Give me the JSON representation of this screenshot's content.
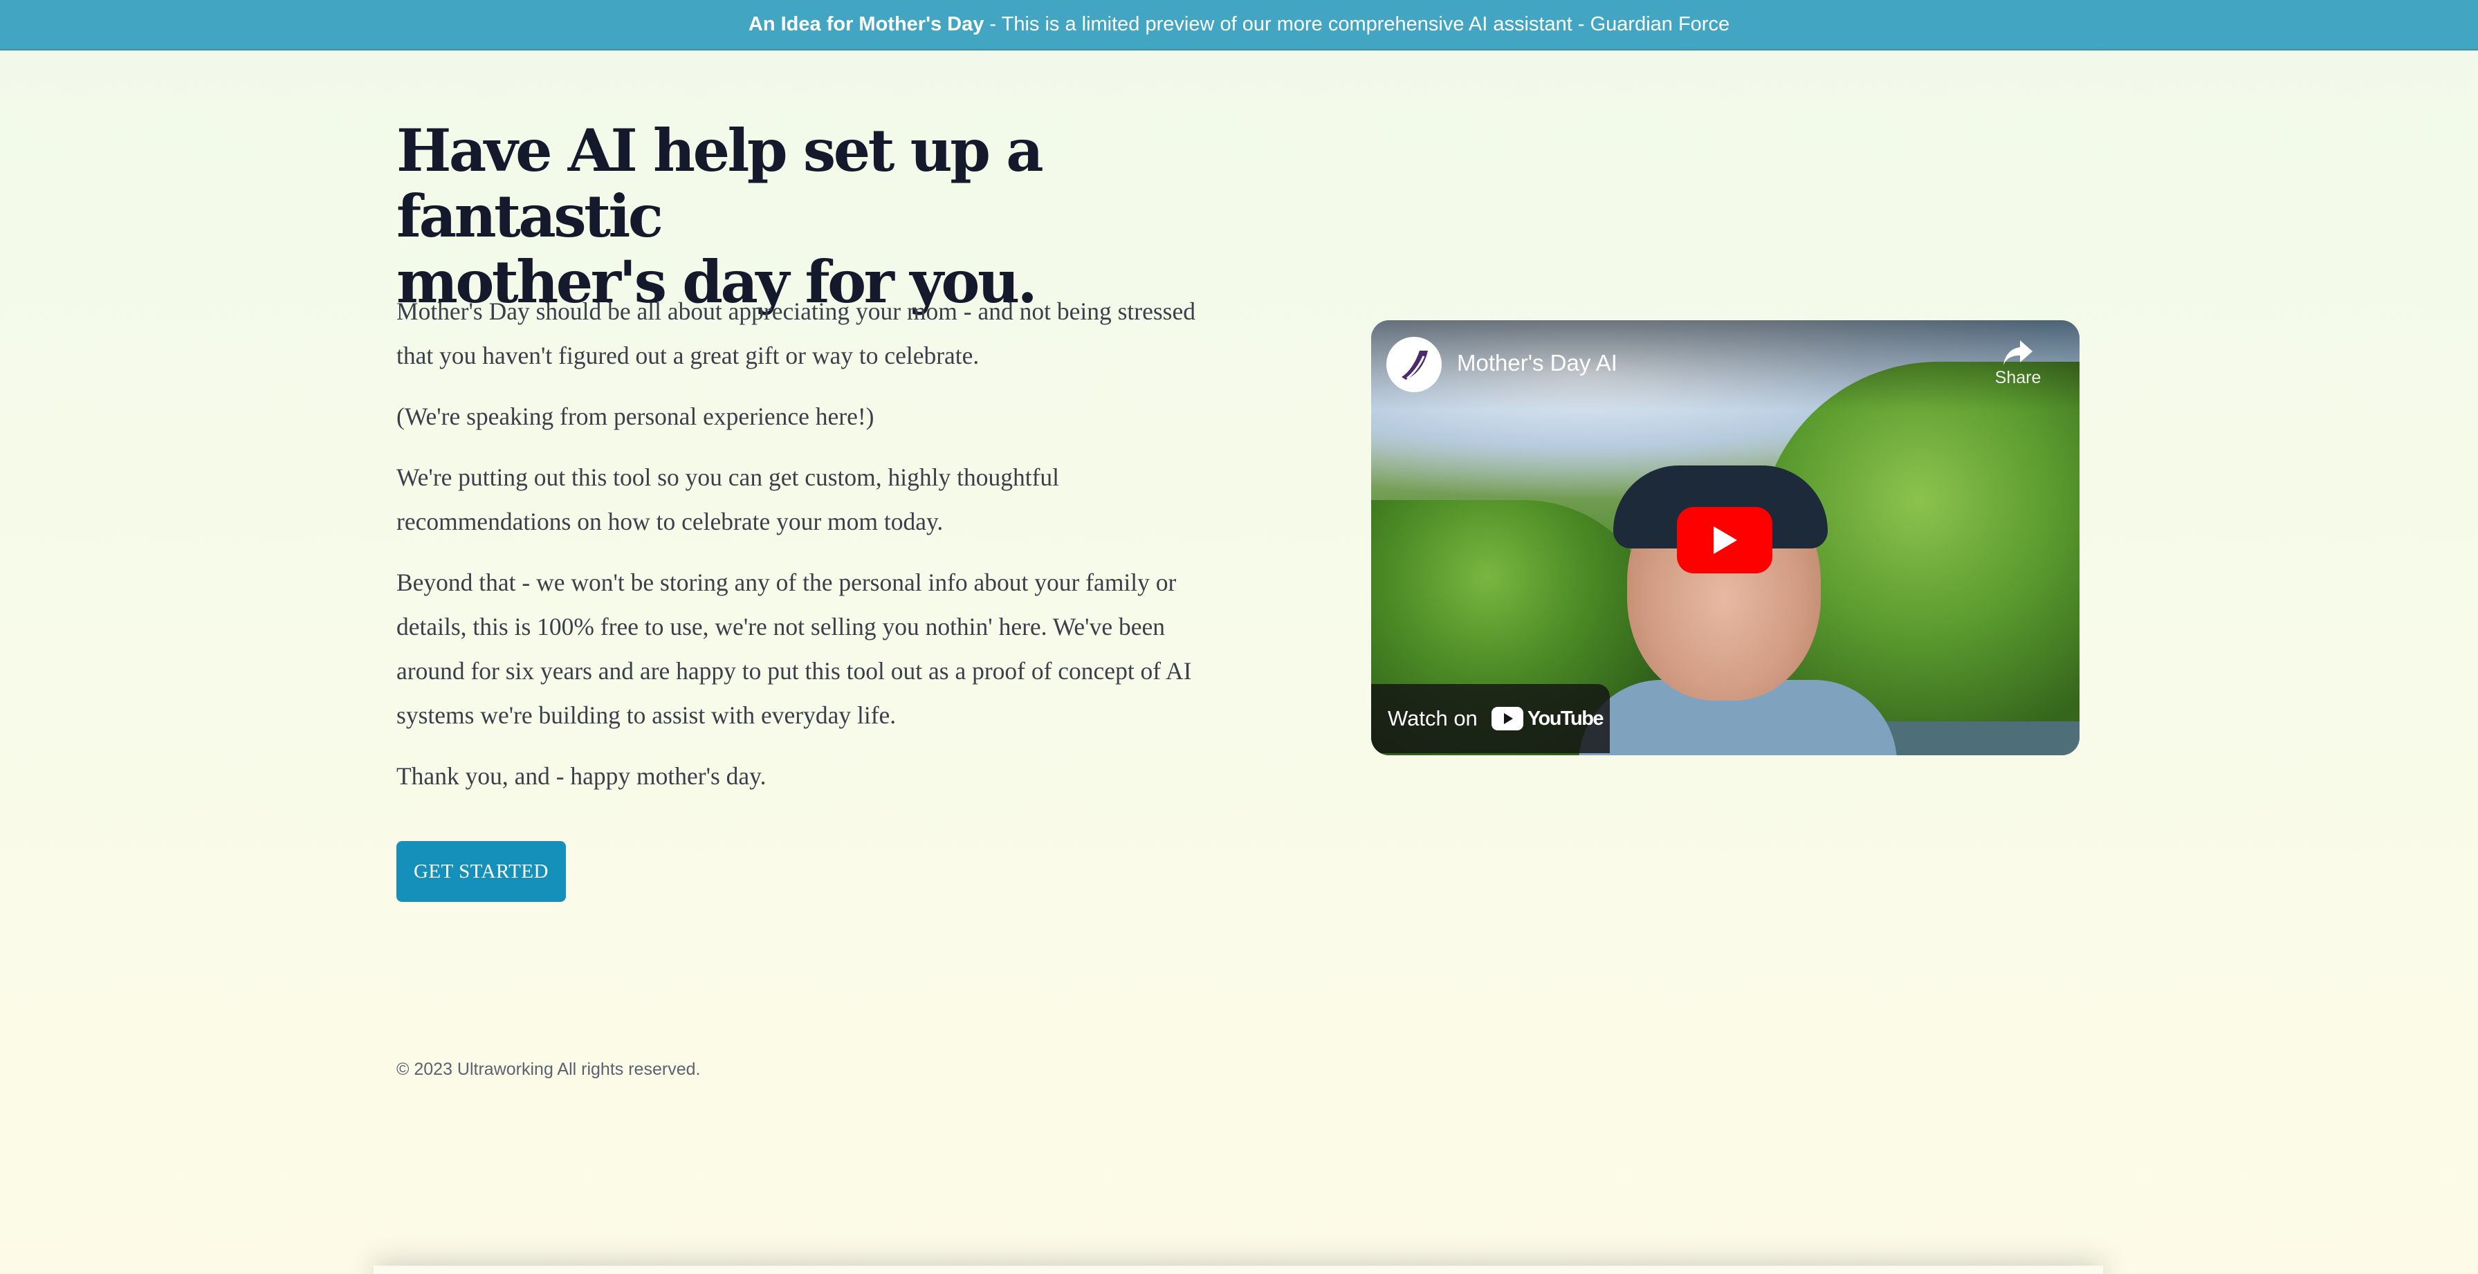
{
  "banner": {
    "bold_text": "An Idea for Mother's Day",
    "text": " - This is a limited preview of our more comprehensive AI assistant - Guardian Force",
    "color": "#42a6c3"
  },
  "hero": {
    "headline_line1": "Have AI help set up a fantastic",
    "headline_line2": "mother's day for you.",
    "paragraphs": [
      "Mother's Day should be all about appreciating your mom - and not being stressed that you haven't figured out a great gift or way to celebrate.",
      "(We're speaking from personal experience here!)",
      "We're putting out this tool so you can get custom, highly thoughtful recommendations on how to celebrate your mom today.",
      "Beyond that - we won't be storing any of the personal info about your family or details, this is 100% free to use, we're not selling you nothin' here. We've been around for six years and are happy to put this tool out as a proof of concept of AI systems we're building to assist with everyday life.",
      "Thank you, and - happy mother's day."
    ],
    "cta_label": "GET STARTED",
    "cta_color": "#1590ba"
  },
  "video": {
    "title": "Mother's Day AI",
    "share_label": "Share",
    "watch_on_label": "Watch on",
    "youtube_label": "YouTube",
    "play_color": "#ff0000"
  },
  "footer": {
    "copyright": "© 2023 Ultraworking All rights reserved."
  }
}
